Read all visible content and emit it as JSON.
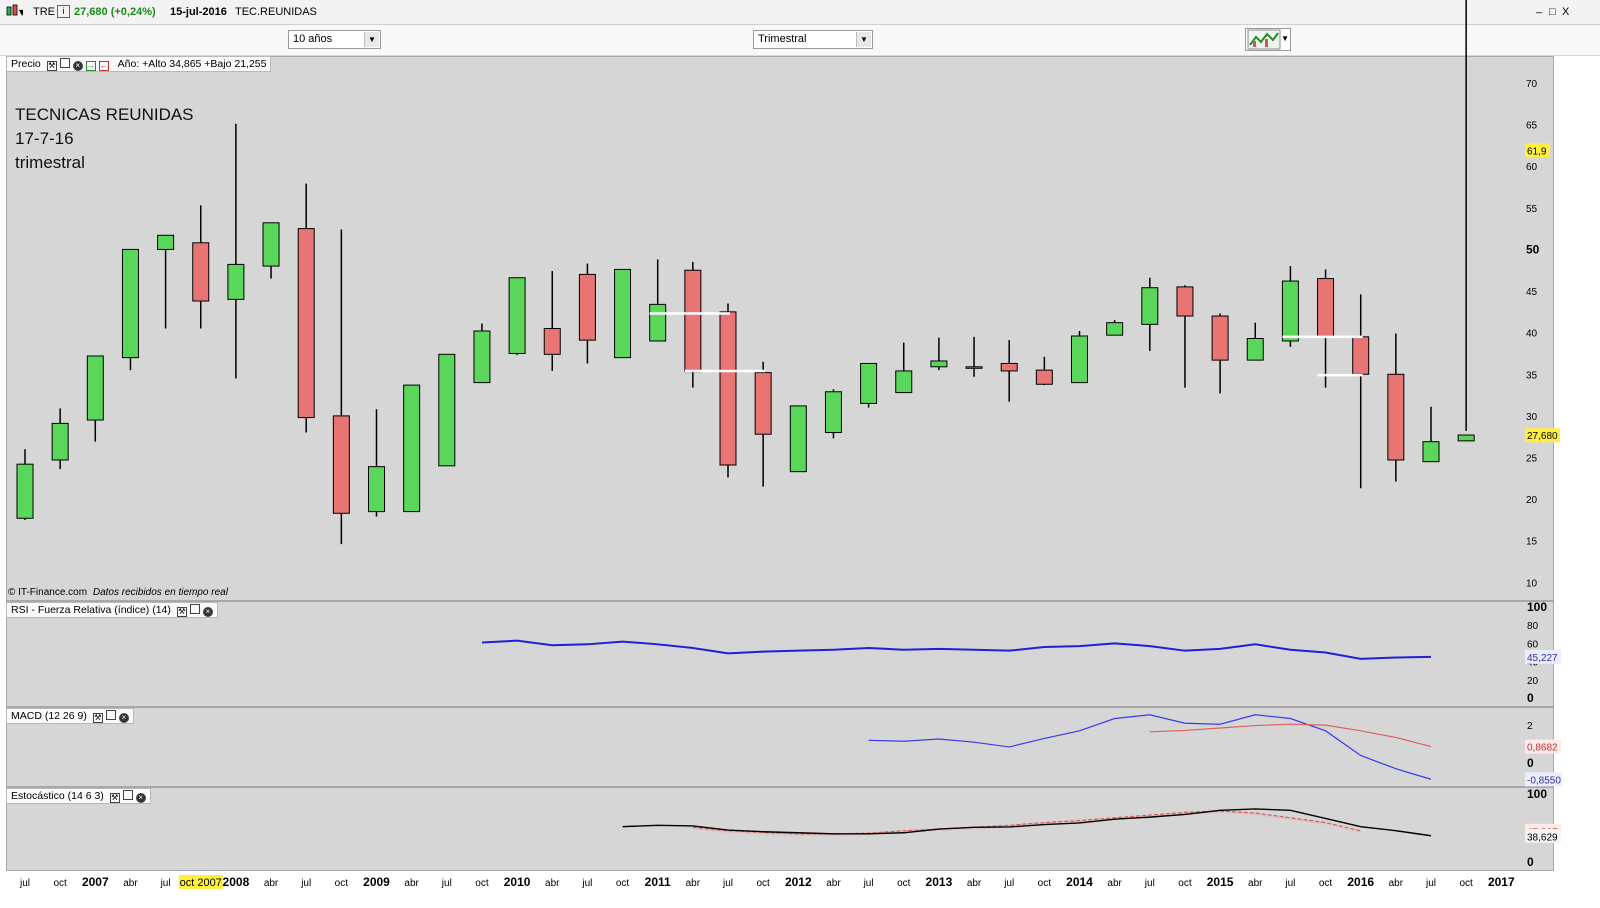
{
  "window": {
    "ticker": "TRE",
    "quote": "27,680 (+0,24%)",
    "date": "15-jul-2016",
    "name": "TEC.REUNIDAS",
    "minimize": "_",
    "restore": "□",
    "close": "X"
  },
  "toolbar": {
    "period_select": "10 años",
    "interval_select": "Trimestral",
    "dropdown_arrow": "▼"
  },
  "price_panel": {
    "label": "Precio",
    "year_range": "Año: +Alto 34,865 +Bajo 21,255",
    "annotation": [
      "TECNICAS REUNIDAS",
      "17-7-16",
      "trimestral"
    ],
    "copyright": "© IT-Finance.com",
    "copyright_note": "Datos recibidos en tiempo real",
    "marker_high": "61,9",
    "marker_last": "27,680"
  },
  "rsi_panel": {
    "label": "RSI - Fuerza Relativa (índice) (14)",
    "marker": "45,227"
  },
  "macd_panel": {
    "label": "MACD (12 26 9)",
    "marker_signal": "0,8682",
    "marker_macd": "-0,8550"
  },
  "stoch_panel": {
    "label": "Estocástico (14 6 3)",
    "marker_d": "45,867",
    "marker_k": "38,629"
  },
  "colors": {
    "up": "#5ad65a",
    "down": "#e87474",
    "panel_bg": "#d6d6d6",
    "rsi_line": "#2020d8",
    "macd_line": "#3a3aee",
    "signal_line": "#e06060",
    "stoch_k": "#000000",
    "stoch_d": "#d06060",
    "highlight": "#ffef40"
  },
  "chart_data": [
    {
      "type": "candlestick",
      "title": "TECNICAS REUNIDAS",
      "interval": "Trimestral",
      "x": [
        "jul 2006",
        "oct 2006",
        "2007",
        "abr 2007",
        "jul 2007",
        "oct 2007",
        "2008",
        "abr 2008",
        "jul 2008",
        "oct 2008",
        "2009",
        "abr 2009",
        "jul 2009",
        "oct 2009",
        "2010",
        "abr 2010",
        "jul 2010",
        "oct 2010",
        "2011",
        "abr 2011",
        "jul 2011",
        "oct 2011",
        "2012",
        "abr 2012",
        "jul 2012",
        "oct 2012",
        "2013",
        "abr 2013",
        "jul 2013",
        "oct 2013",
        "2014",
        "abr 2014",
        "jul 2014",
        "oct 2014",
        "2015",
        "abr 2015",
        "jul 2015",
        "oct 2015",
        "2016",
        "abr 2016",
        "jul 2016"
      ],
      "open": [
        17.7,
        24.7,
        29.5,
        37,
        50,
        50.8,
        44,
        48,
        52.5,
        30,
        18.5,
        18.5,
        24,
        34,
        37.5,
        40.5,
        47,
        37,
        39,
        47.5,
        42.5,
        35.2,
        23.3,
        28,
        31.5,
        32.8,
        35.9,
        35.8,
        36.3,
        35.5,
        34,
        39.7,
        41,
        45.5,
        42,
        36.7,
        39,
        46.5,
        39.5,
        35,
        24.5,
        27
      ],
      "high": [
        26,
        30.9,
        34.7,
        37.3,
        50.1,
        55.3,
        65.1,
        49.8,
        57.9,
        52.4,
        30.8,
        25.6,
        34.3,
        41.1,
        41,
        47.4,
        48.3,
        43.4,
        48.8,
        48.5,
        43.5,
        36.5,
        30.9,
        33.2,
        33.3,
        38.8,
        39.4,
        39.5,
        39.1,
        37.1,
        40.2,
        41.5,
        46.6,
        45.7,
        42.3,
        41.2,
        48,
        47.6,
        44.6,
        39.9,
        31.1,
        28.2
      ],
      "low": [
        17.5,
        23.6,
        26.9,
        35.5,
        40.5,
        40.5,
        34.5,
        46.5,
        28,
        14.6,
        17.9,
        23.6,
        31.1,
        34.2,
        37.3,
        35.4,
        36.3,
        38.9,
        39.4,
        33.4,
        22.6,
        21.5,
        27.5,
        27.3,
        31,
        33.5,
        35.5,
        34.7,
        31.7,
        33.7,
        37.4,
        40.5,
        37.8,
        33.4,
        32.7,
        38.6,
        38.3,
        33.4,
        21.3,
        22.1,
        25.4
      ],
      "close": [
        24.2,
        29.1,
        37.2,
        50,
        51.7,
        43.8,
        48.2,
        53.2,
        29.8,
        18.3,
        23.9,
        33.7,
        37.4,
        40.2,
        46.6,
        37.4,
        39.1,
        47.6,
        43.4,
        35.3,
        24.1,
        27.8,
        31.2,
        32.9,
        36.3,
        35.4,
        36.6,
        35.9,
        35.4,
        33.8,
        39.6,
        41.2,
        45.4,
        42,
        36.7,
        39.3,
        46.2,
        39.5,
        35,
        24.7,
        26.9,
        27.7
      ],
      "ylim": [
        8,
        73
      ],
      "yticks": [
        10,
        15,
        20,
        25,
        30,
        35,
        40,
        45,
        50,
        55,
        60,
        65,
        70
      ],
      "ytick_labels": [
        "10",
        "15",
        "20",
        "25",
        "30",
        "35",
        "40",
        "45",
        "50",
        "55",
        "60",
        "65",
        "70"
      ],
      "xtick_labels": [
        "jul",
        "oct",
        "2007",
        "abr",
        "jul",
        "oct 2007",
        "2008",
        "abr",
        "jul",
        "oct",
        "2009",
        "abr",
        "jul",
        "oct",
        "2010",
        "abr",
        "jul",
        "oct",
        "2011",
        "abr",
        "jul",
        "oct",
        "2012",
        "abr",
        "jul",
        "oct",
        "2013",
        "abr",
        "jul",
        "oct",
        "2014",
        "abr",
        "jul",
        "oct",
        "2015",
        "abr",
        "jul",
        "oct",
        "2016",
        "abr",
        "jul",
        "oct",
        "2017"
      ],
      "support_lines": [
        {
          "y": 42.3,
          "from": "2011",
          "to": "jul 2011"
        },
        {
          "y": 35.4,
          "from": "abr 2011",
          "to": "oct 2011"
        },
        {
          "y": 39.5,
          "from": "jul 2015",
          "to": "2016"
        },
        {
          "y": 34.9,
          "from": "oct 2015",
          "to": "2016"
        }
      ]
    },
    {
      "type": "line",
      "title": "RSI - Fuerza Relativa (índice) (14)",
      "x_start": "oct 2009",
      "values": [
        61,
        63,
        58,
        59,
        62,
        59,
        55,
        49,
        51,
        52,
        53,
        55,
        53,
        54,
        53,
        52,
        56,
        57,
        60,
        57,
        52,
        54,
        59,
        53,
        50,
        43,
        44.5,
        45.2
      ],
      "ylim": [
        0,
        100
      ],
      "yticks": [
        0,
        20,
        40,
        60,
        80,
        100
      ],
      "ytick_labels": [
        "0",
        "20",
        "40",
        "60",
        "80",
        "100"
      ]
    },
    {
      "type": "line",
      "title": "MACD (12 26 9)",
      "series": [
        {
          "name": "MACD",
          "x_start": "jul 2012",
          "values": [
            1.2,
            1.15,
            1.27,
            1.1,
            0.85,
            1.3,
            1.7,
            2.35,
            2.55,
            2.1,
            2.05,
            2.55,
            2.35,
            1.7,
            0.4,
            -0.3,
            -0.855
          ]
        },
        {
          "name": "Señal",
          "x_start": "jul 2014",
          "values": [
            1.65,
            1.72,
            1.85,
            1.98,
            2.05,
            2.0,
            1.7,
            1.35,
            0.87
          ]
        }
      ],
      "ylim": [
        -1.0,
        2.8
      ],
      "yticks": [
        0,
        2
      ],
      "ytick_labels": [
        "0",
        "2"
      ]
    },
    {
      "type": "line",
      "title": "Estocástico (14 6 3)",
      "series": [
        {
          "name": "%K",
          "x_start": "oct 2010",
          "values": [
            52,
            54,
            53,
            47,
            44.5,
            43,
            41.5,
            41.5,
            43,
            48.5,
            51,
            51.5,
            55,
            57.5,
            63,
            66,
            70,
            76,
            78,
            76,
            64,
            52,
            46,
            38.6
          ]
        },
        {
          "name": "%D",
          "x_start": "abr 2011",
          "values": [
            51,
            46,
            43.5,
            41.5,
            41,
            42.5,
            46,
            48.5,
            51,
            54,
            58,
            61,
            65,
            69,
            73,
            75,
            72,
            65,
            58,
            45.9
          ]
        }
      ],
      "ylim": [
        0,
        100
      ],
      "yticks": [
        0,
        100
      ],
      "ytick_labels": [
        "0",
        "100"
      ]
    }
  ]
}
